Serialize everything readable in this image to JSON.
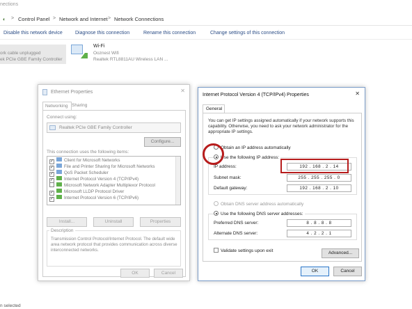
{
  "window": {
    "title": "nections"
  },
  "address_bar": {
    "segments": [
      "Control Panel",
      "Network and Internet",
      "Network Connections"
    ],
    "separator": ">"
  },
  "command_bar": {
    "items": [
      "Disable this network device",
      "Diagnose this connection",
      "Rename this connection",
      "Change settings of this connection"
    ]
  },
  "adapters": [
    {
      "name": "",
      "status": "ork cable unplugged",
      "device": "ek PCIe GBE Family Controller",
      "selected": true
    },
    {
      "name": "Wi-Fi",
      "status": "Ooznest Wifi",
      "device": "Realtek RTL8811AU Wireless LAN ...",
      "selected": false
    }
  ],
  "status_bar": {
    "text": "n selected"
  },
  "ethernet_properties": {
    "title": "Ethernet Properties",
    "tabs": [
      "Networking",
      "Sharing"
    ],
    "connect_using_label": "Connect using:",
    "adapter_name": "Realtek PCIe GBE Family Controller",
    "configure_button": "Configure...",
    "items_label": "This connection uses the following items:",
    "items": [
      {
        "label": "Client for Microsoft Networks",
        "checked": true
      },
      {
        "label": "File and Printer Sharing for Microsoft Networks",
        "checked": true
      },
      {
        "label": "QoS Packet Scheduler",
        "checked": true
      },
      {
        "label": "Internet Protocol Version 4 (TCP/IPv4)",
        "checked": true
      },
      {
        "label": "Microsoft Network Adapter Multiplexor Protocol",
        "checked": false
      },
      {
        "label": "Microsoft LLDP Protocol Driver",
        "checked": true
      },
      {
        "label": "Internet Protocol Version 6 (TCP/IPv6)",
        "checked": true
      }
    ],
    "install_button": "Install...",
    "uninstall_button": "Uninstall",
    "properties_button": "Properties",
    "description_title": "Description",
    "description_text": "Transmission Control Protocol/Internet Protocol. The default wide area network protocol that provides communication across diverse interconnected networks.",
    "ok_button": "OK",
    "cancel_button": "Cancel"
  },
  "ipv4_properties": {
    "title": "Internet Protocol Version 4 (TCP/IPv4) Properties",
    "tab": "General",
    "intro": "You can get IP settings assigned automatically if your network supports this capability. Otherwise, you need to ask your network administrator for the appropriate IP settings.",
    "obtain_auto_ip": "Obtain an IP address automatically",
    "use_following_ip": "Use the following IP address:",
    "ip_label": "IP address:",
    "ip_value": "192 . 168 . 2 . 14",
    "subnet_label": "Subnet mask:",
    "subnet_value": "255 . 255 . 255 . 0",
    "gateway_label": "Default gateway:",
    "gateway_value": "192 . 168 . 2 . 10",
    "obtain_auto_dns": "Obtain DNS server address automatically",
    "use_following_dns": "Use the following DNS server addresses:",
    "preferred_dns_label": "Preferred DNS server:",
    "preferred_dns_value": "8 . 8 . 8 . 8",
    "alternate_dns_label": "Alternate DNS server:",
    "alternate_dns_value": "4 . 2 . 2 . 1",
    "validate_label": "Validate settings upon exit",
    "advanced_button": "Advanced...",
    "ok_button": "OK",
    "cancel_button": "Cancel",
    "close_glyph": "✕"
  },
  "colors": {
    "highlight": "#b71c1c",
    "link": "#2b4d86",
    "accent": "#2a75c8"
  }
}
